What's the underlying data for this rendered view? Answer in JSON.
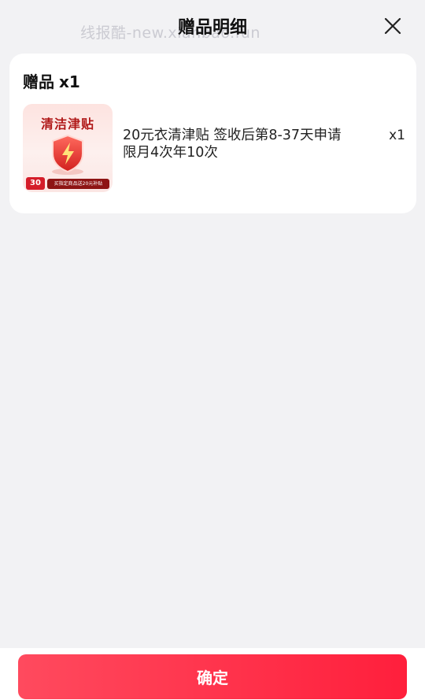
{
  "header": {
    "title": "赠品明细",
    "watermark": "线报酷-new.xianbao.fun",
    "close_icon": "close-icon"
  },
  "gift_card": {
    "title": "赠品",
    "count": "x1",
    "items": [
      {
        "name": "20元衣清津贴 签收后第8-37天申请 限月4次年10次",
        "quantity": "x1",
        "thumbnail": {
          "title": "清洁津贴",
          "badge": "30",
          "banner": "买指定商品送20元补贴",
          "icon": "shield-lightning-icon"
        }
      }
    ]
  },
  "footer": {
    "confirm_label": "确定"
  },
  "colors": {
    "background": "#f2f2f4",
    "card": "#ffffff",
    "accent": "#ff2a45",
    "thumb_red": "#b01818"
  }
}
